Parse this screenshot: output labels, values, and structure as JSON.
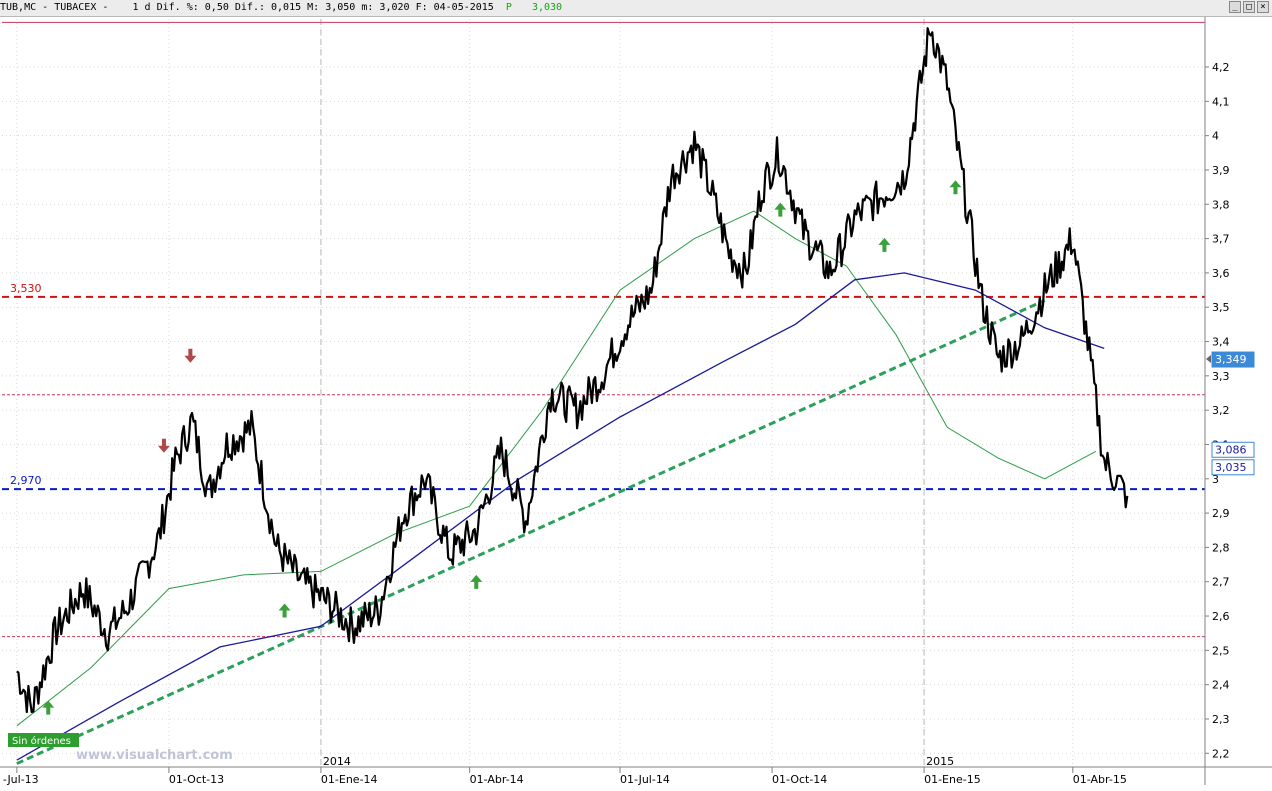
{
  "header": {
    "symbol": "TUB,MC",
    "name": "TUBACEX",
    "period": "1 d",
    "dif_pct": "Dif. %: 0,50",
    "dif": "Dif.: 0,015",
    "max": "M: 3,050",
    "min": "m: 3,020",
    "date": "F: 04-05-2015",
    "price_label": "P",
    "price_value": "3,030"
  },
  "window_controls": {
    "minimize": "_",
    "restore": "□",
    "close": "×"
  },
  "watermark": "www.visualchart.com",
  "status_badge": "Sin órdenes",
  "colors": {
    "price": "#000000",
    "ma_short": "#2e9e48",
    "ma_long": "#1a1a9a",
    "trendline": "#2aa05a",
    "resistance": "#d01010",
    "support": "#0a1ac8",
    "pink": "#c8385a",
    "buy_arrow": "#3aa03a",
    "sell_arrow": "#b04848",
    "badge_bg": "#2e9e2e"
  },
  "chart_data": {
    "type": "line",
    "title": "TUB,MC - TUBACEX - 1 d",
    "ylim": [
      2.16,
      4.34
    ],
    "y_ticks": [
      "2,2",
      "2,3",
      "2,4",
      "2,5",
      "2,6",
      "2,7",
      "2,8",
      "2,9",
      "3",
      "3,1",
      "3,2",
      "3,3",
      "3,4",
      "3,5",
      "3,6",
      "3,7",
      "3,8",
      "3,9",
      "4",
      "4,1",
      "4,2"
    ],
    "x_labels": [
      "-Jul-13",
      "01-Oct-13",
      "01-Ene-14",
      "01-Abr-14",
      "01-Jul-14",
      "01-Oct-14",
      "01-Ene-15",
      "01-Abr-15"
    ],
    "year_labels": [
      "2014",
      "2015"
    ],
    "series": [
      {
        "role": "price",
        "x": [
          "2013-07-01",
          "2013-07-10",
          "2013-07-25",
          "2013-08-10",
          "2013-08-25",
          "2013-09-05",
          "2013-09-15",
          "2013-09-25",
          "2013-10-05",
          "2013-10-15",
          "2013-10-25",
          "2013-11-05",
          "2013-11-20",
          "2013-12-05",
          "2013-12-20",
          "2014-01-05",
          "2014-01-20",
          "2014-02-05",
          "2014-02-20",
          "2014-03-05",
          "2014-03-20",
          "2014-04-05",
          "2014-04-20",
          "2014-05-05",
          "2014-05-20",
          "2014-06-05",
          "2014-06-20",
          "2014-07-05",
          "2014-07-20",
          "2014-08-01",
          "2014-08-15",
          "2014-08-25",
          "2014-09-05",
          "2014-09-15",
          "2014-09-25",
          "2014-10-05",
          "2014-10-20",
          "2014-11-05",
          "2014-11-20",
          "2014-12-05",
          "2014-12-20",
          "2015-01-05",
          "2015-01-15",
          "2015-01-25",
          "2015-02-05",
          "2015-02-15",
          "2015-03-01",
          "2015-03-15",
          "2015-04-01",
          "2015-04-10",
          "2015-04-20",
          "2015-05-04"
        ],
        "y": [
          2.44,
          2.33,
          2.56,
          2.68,
          2.55,
          2.62,
          2.72,
          2.83,
          3.05,
          3.17,
          2.96,
          3.1,
          3.15,
          2.8,
          2.7,
          2.64,
          2.57,
          2.62,
          2.9,
          3.0,
          2.78,
          2.85,
          3.08,
          2.88,
          3.25,
          3.2,
          3.3,
          3.45,
          3.55,
          3.88,
          3.98,
          3.84,
          3.66,
          3.6,
          3.85,
          3.95,
          3.72,
          3.6,
          3.76,
          3.82,
          3.88,
          4.32,
          4.15,
          3.85,
          3.52,
          3.35,
          3.4,
          3.55,
          3.7,
          3.4,
          3.05,
          2.95
        ],
        "note": "approximate daily close path"
      },
      {
        "role": "ma_short",
        "x": [
          "2013-07-01",
          "2013-08-15",
          "2013-10-01",
          "2013-11-15",
          "2014-01-01",
          "2014-02-15",
          "2014-04-01",
          "2014-05-15",
          "2014-07-01",
          "2014-08-15",
          "2014-09-20",
          "2014-10-15",
          "2014-11-15",
          "2014-12-15",
          "2015-01-15",
          "2015-02-15",
          "2015-03-15",
          "2015-04-15"
        ],
        "y": [
          2.28,
          2.45,
          2.68,
          2.72,
          2.73,
          2.84,
          2.92,
          3.2,
          3.55,
          3.7,
          3.78,
          3.7,
          3.62,
          3.42,
          3.15,
          3.06,
          3.0,
          3.08
        ]
      },
      {
        "role": "ma_long",
        "x": [
          "2013-07-01",
          "2013-09-01",
          "2013-11-01",
          "2014-01-01",
          "2014-03-01",
          "2014-05-01",
          "2014-07-01",
          "2014-09-01",
          "2014-10-15",
          "2014-11-20",
          "2014-12-20",
          "2015-02-01",
          "2015-03-15",
          "2015-04-20"
        ],
        "y": [
          2.18,
          2.35,
          2.51,
          2.57,
          2.78,
          3.0,
          3.18,
          3.34,
          3.45,
          3.58,
          3.6,
          3.55,
          3.44,
          3.38
        ]
      }
    ],
    "horizontal_lines": [
      {
        "role": "top",
        "y": 4.33
      },
      {
        "role": "resistance",
        "y": 3.53,
        "label": "3,530"
      },
      {
        "role": "pink-mid",
        "y": 3.245
      },
      {
        "role": "support",
        "y": 2.97,
        "label": "2,970"
      },
      {
        "role": "pink-low",
        "y": 2.54
      }
    ],
    "trendline": {
      "from": [
        "2013-07-01",
        2.17
      ],
      "to": [
        "2015-03-15",
        3.52
      ]
    },
    "signals": {
      "buy": [
        "2013-07-20",
        "2013-12-10",
        "2014-04-05",
        "2014-10-06",
        "2014-12-08",
        "2015-01-20"
      ],
      "sell": [
        "2013-09-28",
        "2013-10-14"
      ]
    },
    "price_tags": [
      {
        "value": "3,349",
        "y": 3.349,
        "style": "highlight"
      },
      {
        "value": "3,086",
        "y": 3.086,
        "style": "box"
      },
      {
        "value": "3,035",
        "y": 3.035,
        "style": "box"
      }
    ]
  }
}
